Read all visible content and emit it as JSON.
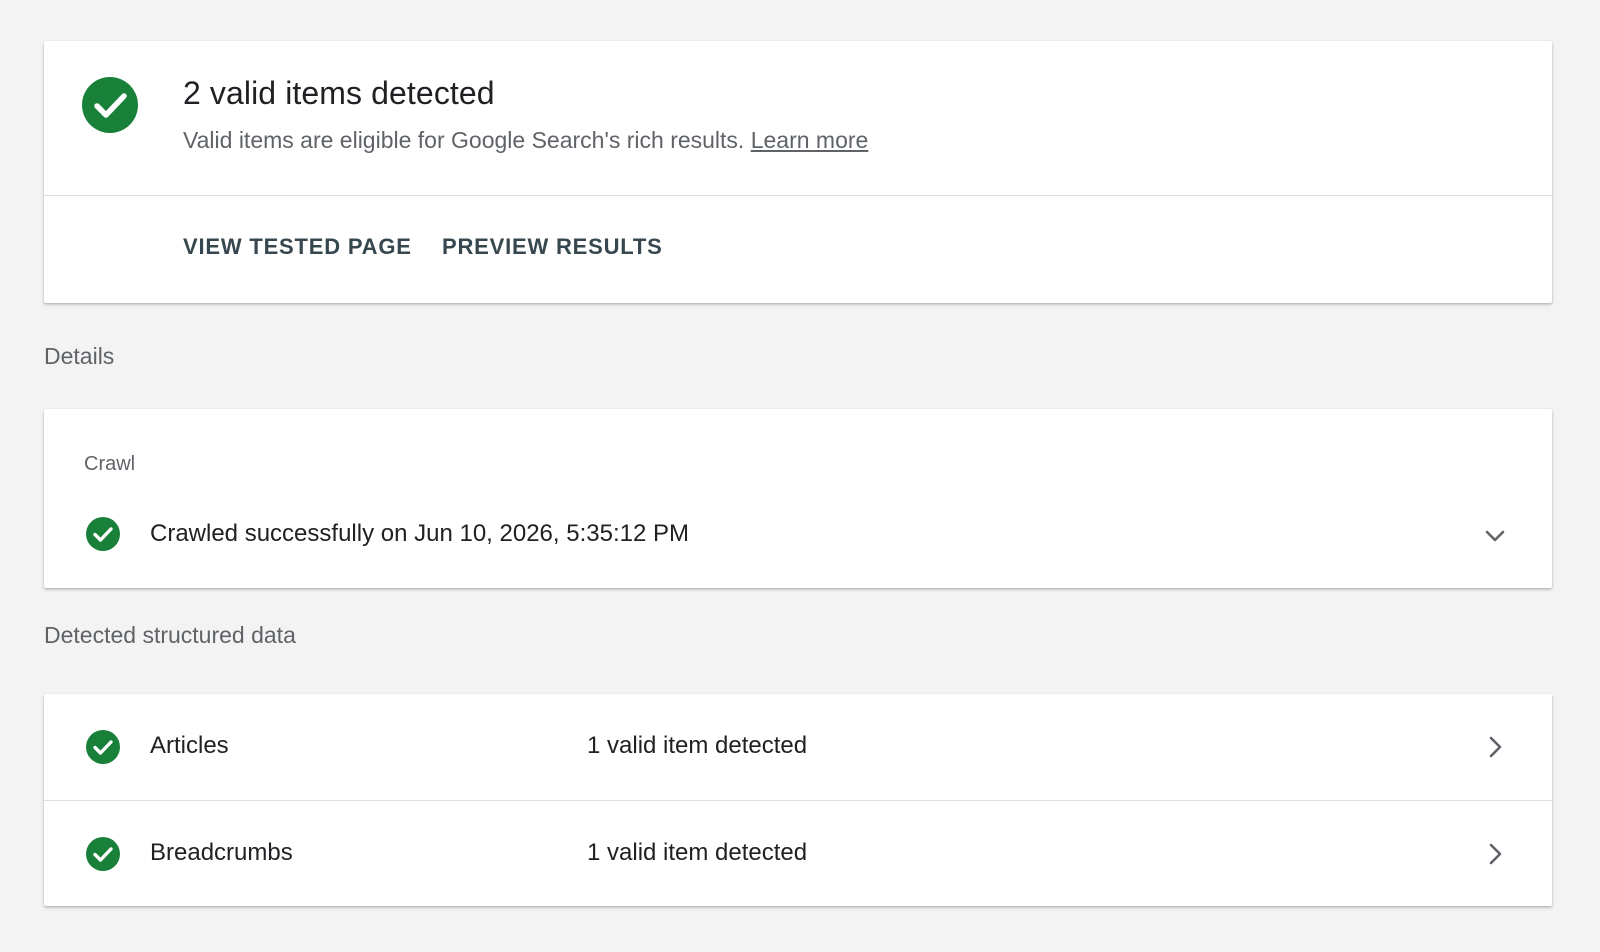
{
  "summary": {
    "title": "2 valid items detected",
    "subtitle": "Valid items are eligible for Google Search's rich results.",
    "learn_more": "Learn more",
    "actions": {
      "view_tested_page": "VIEW TESTED PAGE",
      "preview_results": "PREVIEW RESULTS"
    }
  },
  "details": {
    "section_label": "Details",
    "crawl": {
      "heading": "Crawl",
      "status_text": "Crawled successfully on Jun 10, 2026, 5:35:12 PM"
    }
  },
  "structured_data": {
    "section_label": "Detected structured data",
    "items": [
      {
        "name": "Articles",
        "status": "1 valid item detected"
      },
      {
        "name": "Breadcrumbs",
        "status": "1 valid item detected"
      }
    ]
  },
  "colors": {
    "success_green": "#188038",
    "action_text": "#37474f",
    "background": "#f3f3f3"
  },
  "icons": {
    "status": "check-circle-icon",
    "expand": "chevron-down-icon",
    "open": "chevron-right-icon"
  }
}
